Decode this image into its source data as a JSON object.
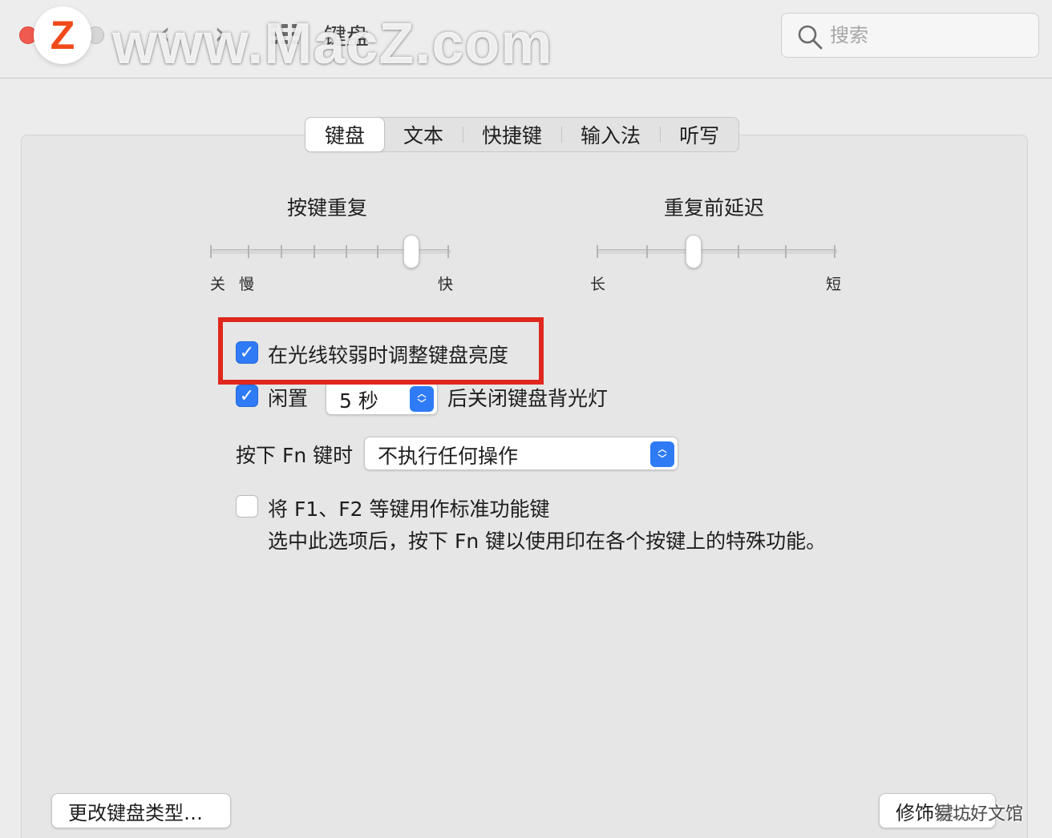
{
  "window": {
    "title": "键盘",
    "watermark": "www.MacZ.com",
    "logo_letter": "Z"
  },
  "toolbar": {
    "back_glyph": "‹",
    "forward_glyph": "›",
    "search_placeholder": "搜索"
  },
  "tabs": [
    {
      "label": "键盘",
      "active": true
    },
    {
      "label": "文本",
      "active": false
    },
    {
      "label": "快捷键",
      "active": false
    },
    {
      "label": "输入法",
      "active": false
    },
    {
      "label": "听写",
      "active": false
    }
  ],
  "key_repeat": {
    "title": "按键重复",
    "label_off": "关",
    "label_slow": "慢",
    "label_fast": "快",
    "position": "7 of 8"
  },
  "repeat_delay": {
    "title": "重复前延迟",
    "label_long": "长",
    "label_short": "短",
    "position": "3 of 6"
  },
  "settings": {
    "adjust_brightness": {
      "label": "在光线较弱时调整键盘亮度",
      "checked": true
    },
    "idle_backlight": {
      "checked": true,
      "prefix": "闲置",
      "value": "5 秒",
      "suffix": "后关闭键盘背光灯"
    },
    "fn_key": {
      "label": "按下 Fn 键时",
      "value": "不执行任何操作"
    },
    "function_keys": {
      "checked": false,
      "label": "将 F1、F2 等键用作标准功能键",
      "description": "选中此选项后，按下 Fn 键以使用印在各个按键上的特殊功能。"
    }
  },
  "buttons": {
    "change_keyboard_type": "更改键盘类型…",
    "modifier_keys": "修饰键…"
  },
  "corner_watermark": "易坊好文馆",
  "colors": {
    "accent": "#2f7bf5",
    "highlight_border": "#e0271d",
    "close_button": "#f05a4f"
  },
  "icons": {
    "search": "search-icon",
    "grid": "grid-icon",
    "back": "chevron-left-icon",
    "forward": "chevron-right-icon",
    "checkmark": "checkmark-icon",
    "stepper": "up-down-chevron-icon"
  }
}
